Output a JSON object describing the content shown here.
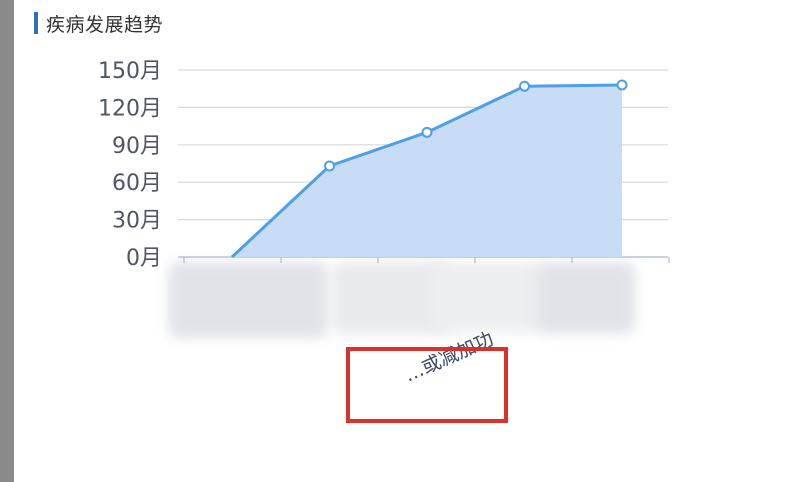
{
  "panel": {
    "title": "疾病发展趋势"
  },
  "colors": {
    "accent": "#2a6fc4",
    "line": "#4ea0e6",
    "area": "#c6daf5",
    "grid": "#d6d9de",
    "highlight": "#d9322d"
  },
  "chart_data": {
    "type": "area",
    "title": "疾病发展趋势",
    "xlabel": "",
    "ylabel": "",
    "yticks": [
      "0月",
      "30月",
      "60月",
      "90月",
      "120月",
      "150月"
    ],
    "ylim": [
      0,
      150
    ],
    "x_labels": [
      "",
      "",
      "",
      "",
      ""
    ],
    "visible_x_label_fragment": "…或减加功",
    "series": [
      {
        "values": [
          0,
          73,
          100,
          137,
          138
        ]
      }
    ],
    "grid": true,
    "markers": true
  }
}
